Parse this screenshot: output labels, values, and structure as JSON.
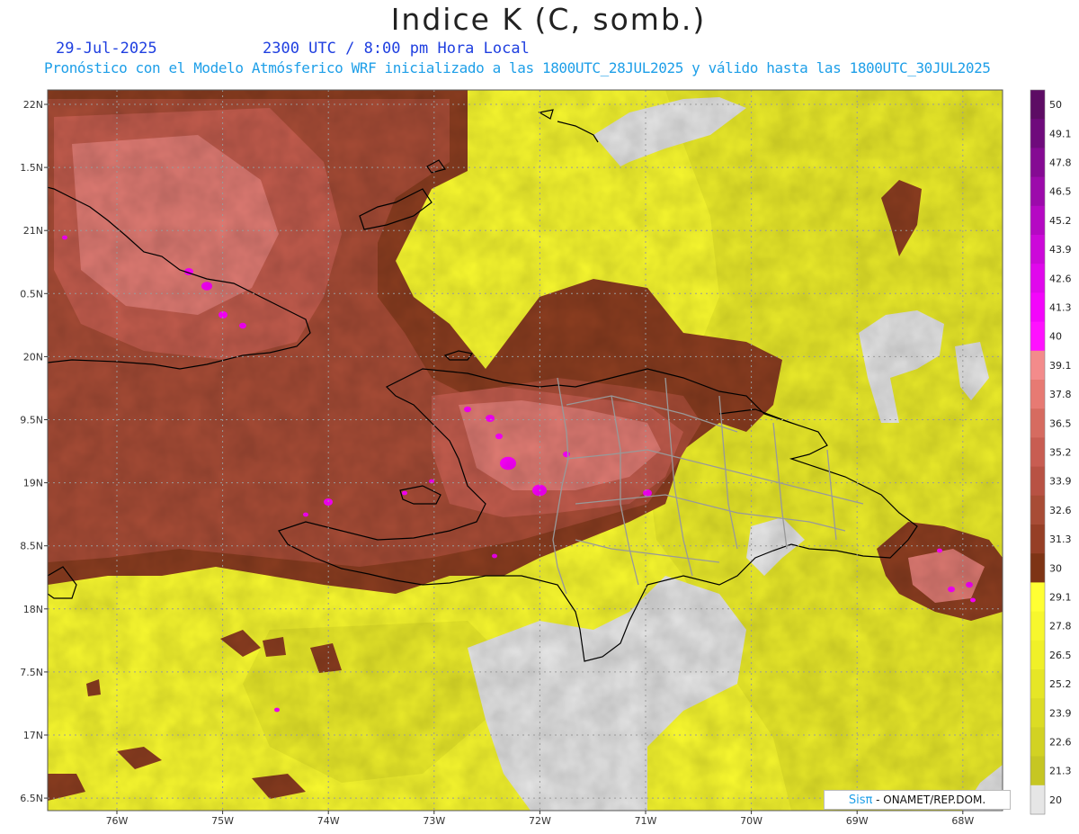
{
  "header": {
    "title": "Indice K (C, somb.)",
    "date": "29-Jul-2025",
    "time": "2300 UTC / 8:00 pm Hora Local",
    "subtitle": "Pronóstico con el Modelo Atmósferico WRF inicializado a las 1800UTC_28JUL2025 y válido hasta las  1800UTC_30JUL2025"
  },
  "map": {
    "lat_labels": [
      "22N",
      "1.5N",
      "21N",
      "0.5N",
      "20N",
      "9.5N",
      "19N",
      "8.5N",
      "18N",
      "7.5N",
      "17N",
      "6.5N"
    ],
    "lon_labels": [
      "76W",
      "75W",
      "74W",
      "73W",
      "72W",
      "71W",
      "70W",
      "69W",
      "68W"
    ],
    "colors": {
      "ocean_cold": "#e6e6e6",
      "yellow_low": "#c7c92b",
      "yellow": "#eded2a",
      "yellow_bright": "#fbfb2f",
      "brown_dark": "#8b3d20",
      "brown": "#a84c36",
      "brown_mid": "#c35c4d",
      "pink": "#e07b73",
      "magenta": "#ff00ff",
      "coast": "#000000",
      "provinces": "#999999",
      "grid": "#9a9a9a"
    }
  },
  "colorbar": {
    "labels": [
      "50",
      "49.1",
      "47.8",
      "46.5",
      "45.2",
      "43.9",
      "42.6",
      "41.3",
      "40",
      "39.1",
      "37.8",
      "36.5",
      "35.2",
      "33.9",
      "32.6",
      "31.3",
      "30",
      "29.1",
      "27.8",
      "26.5",
      "25.2",
      "23.9",
      "22.6",
      "21.3",
      "20"
    ],
    "colors": [
      "#5d0c64",
      "#6f0b7c",
      "#850a93",
      "#9c0aab",
      "#b509c3",
      "#cc09d9",
      "#e008ec",
      "#f306fb",
      "#ff11ff",
      "#f38b8b",
      "#e77a73",
      "#d66b60",
      "#c85d52",
      "#b85244",
      "#a84c36",
      "#963f26",
      "#7e3415",
      "#ffff33",
      "#f7f72d",
      "#f0f028",
      "#e6e626",
      "#dcdc24",
      "#d2d223",
      "#c6c623",
      "#e6e6e6"
    ]
  },
  "credit": {
    "brand": "Sisπ",
    "text": " - ONAMET/REP.DOM."
  }
}
